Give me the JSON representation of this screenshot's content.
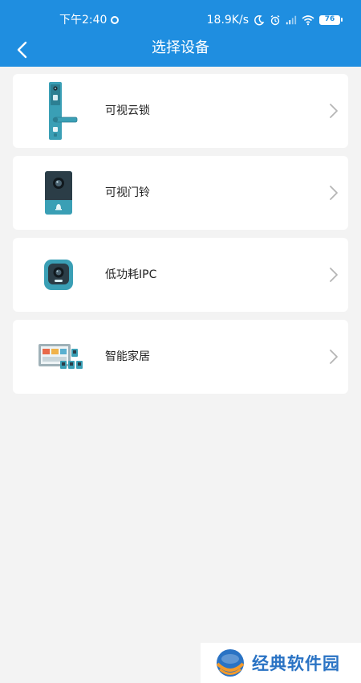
{
  "status_bar": {
    "time": "下午2:40",
    "network_speed": "18.9K/s",
    "battery_level": "76"
  },
  "header": {
    "title": "选择设备"
  },
  "devices": [
    {
      "label": "可视云锁",
      "icon": "smart-lock-icon"
    },
    {
      "label": "可视门铃",
      "icon": "video-doorbell-icon"
    },
    {
      "label": "低功耗IPC",
      "icon": "ipc-camera-icon"
    },
    {
      "label": "智能家居",
      "icon": "smart-home-kit-icon"
    }
  ],
  "watermark": {
    "text": "经典软件园"
  },
  "colors": {
    "header_bg": "#1f8ee0",
    "page_bg": "#f3f3f3",
    "card_bg": "#ffffff",
    "device_teal": "#3a9fb5"
  }
}
